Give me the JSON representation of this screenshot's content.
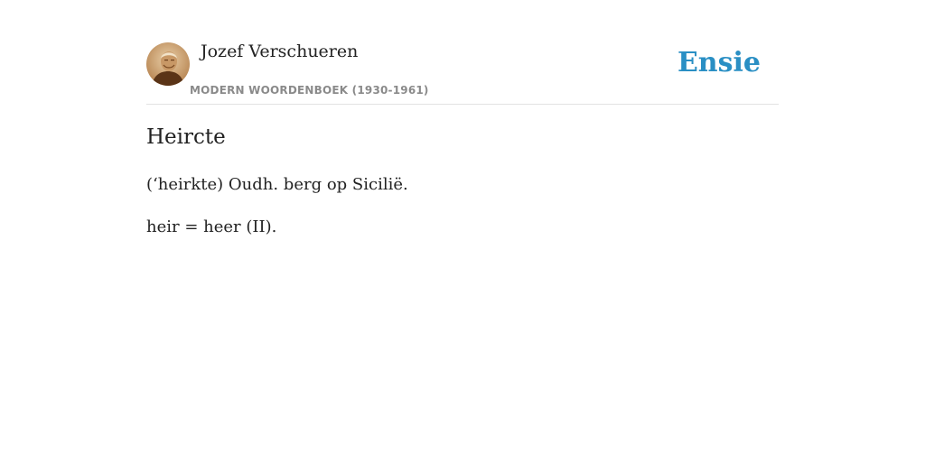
{
  "header": {
    "author": "Jozef Verschueren",
    "source": "MODERN WOORDENBOEK (1930-1961)",
    "brand": "Ensie",
    "brand_color": "#2a8fc4",
    "avatar_icon": "author-portrait"
  },
  "entry": {
    "title": "Heircte",
    "paragraphs": [
      "(‘heirkte) Oudh. berg op Sicilië.",
      "heir = heer (II)."
    ]
  }
}
